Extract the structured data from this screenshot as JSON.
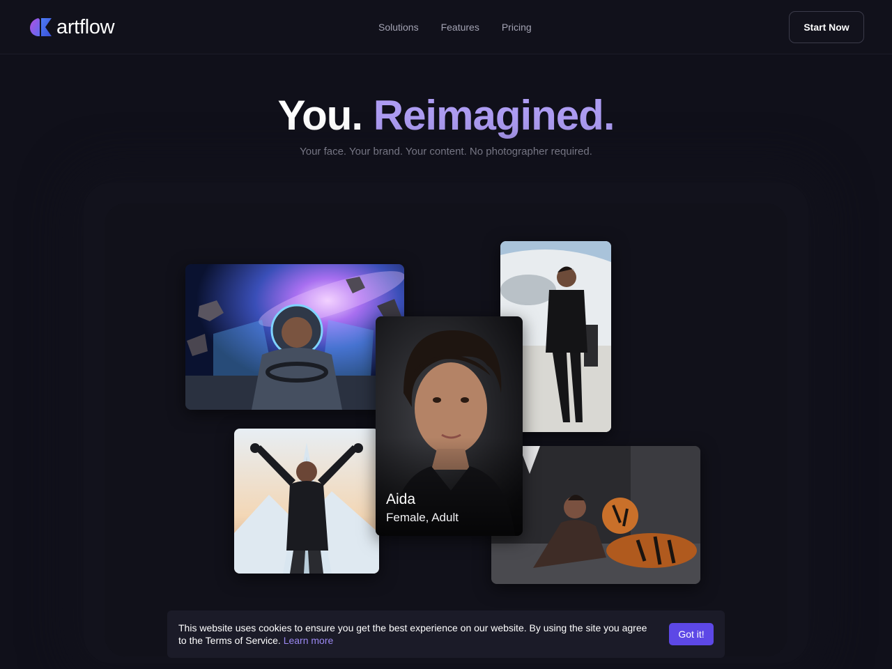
{
  "brand": {
    "name": "artflow"
  },
  "nav": {
    "links": [
      {
        "label": "Solutions"
      },
      {
        "label": "Features"
      },
      {
        "label": "Pricing"
      }
    ],
    "cta_label": "Start Now"
  },
  "hero": {
    "title_plain": "You.",
    "title_accent": "Reimagined.",
    "subtitle": "Your face. Your brand. Your content. No photographer required."
  },
  "showcase": {
    "portrait": {
      "name": "Aida",
      "description": "Female, Adult"
    }
  },
  "cookie": {
    "message": "This website uses cookies to ensure you get the best experience on our website. By using the site you agree to the Terms of Service.",
    "link_label": "Learn more",
    "button_label": "Got it!"
  },
  "colors": {
    "background": "#10101a",
    "accent": "#ad9cf2",
    "button": "#5d48e6",
    "link": "#9b88f2"
  }
}
